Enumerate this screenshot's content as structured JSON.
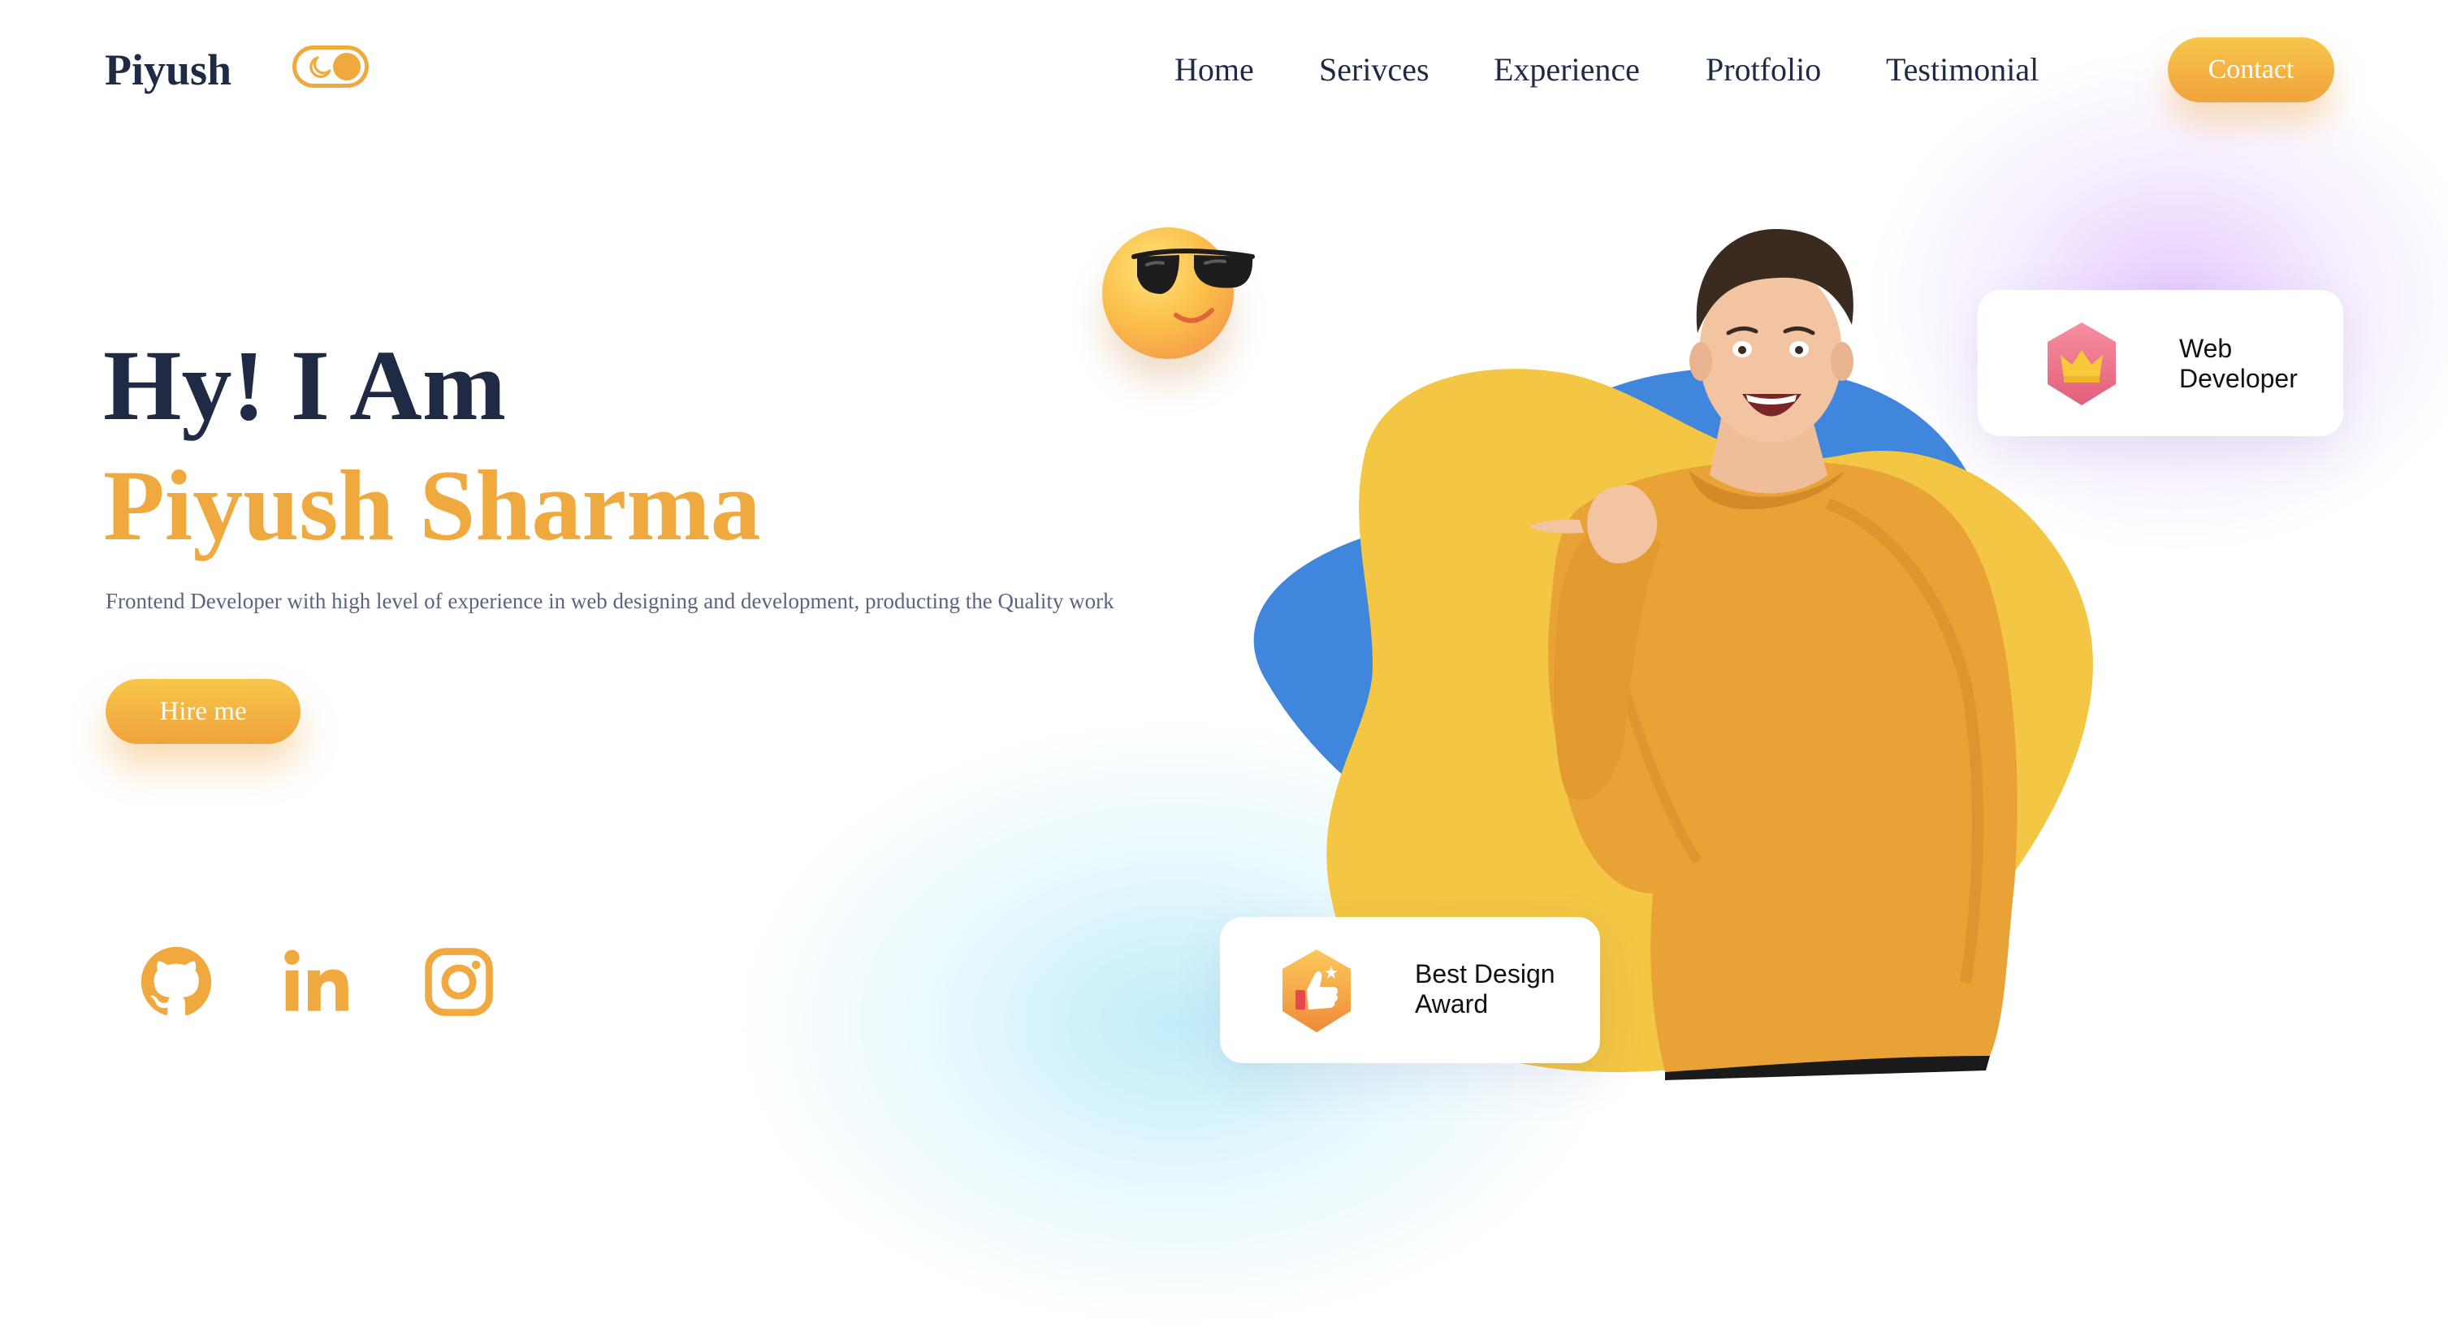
{
  "header": {
    "logo": "Piyush",
    "nav": [
      "Home",
      "Serivces",
      "Experience",
      "Protfolio",
      "Testimonial"
    ],
    "contact_label": "Contact"
  },
  "hero": {
    "greeting": "Hy! I Am",
    "name": "Piyush Sharma",
    "description": "Frontend Developer with high level of experience in web designing and development, producting the Quality work",
    "hire_label": "Hire me"
  },
  "badges": {
    "role_line1": "Web",
    "role_line2": "Developer",
    "award_line1": "Best Design",
    "award_line2": "Award"
  },
  "social": [
    "github-icon",
    "linkedin-icon",
    "instagram-icon"
  ],
  "colors": {
    "accent": "#f0a93e",
    "dark": "#1f2a44",
    "muted": "#5b6480",
    "blob_yellow": "#f3c643",
    "blob_blue": "#3f86dc"
  }
}
